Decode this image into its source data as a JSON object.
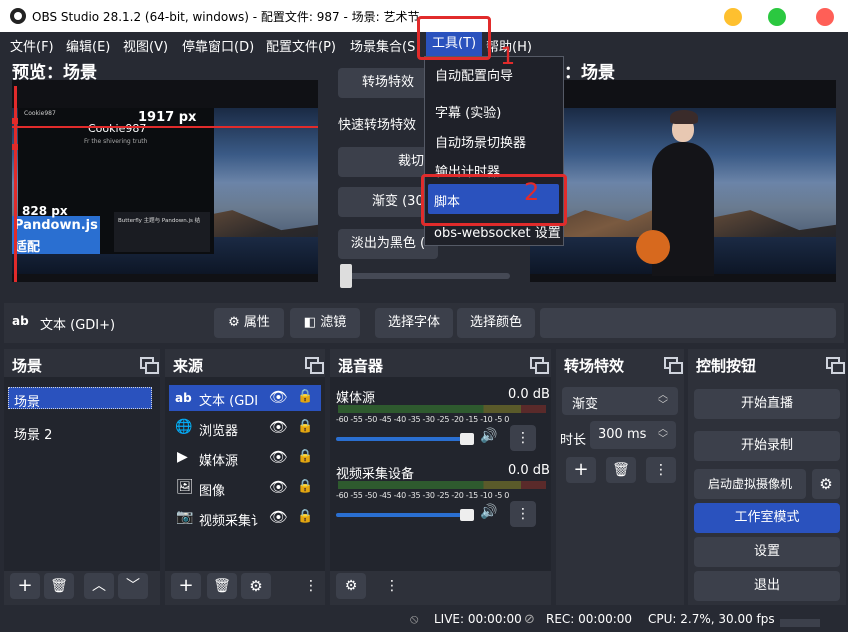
{
  "window": {
    "title": "OBS Studio 28.1.2 (64-bit, windows) - 配置文件: 987 - 场景: 艺术节"
  },
  "menubar": {
    "items": [
      "文件(F)",
      "编辑(E)",
      "视图(V)",
      "停靠窗口(D)",
      "配置文件(P)",
      "场景集合(S",
      "工具(T)",
      "帮助(H)"
    ]
  },
  "preview": {
    "left_title": "预览：场景",
    "right_title": "：场景",
    "overlay": {
      "px_w": "1917 px",
      "px_h": "828 px",
      "user": "Cookie987",
      "big_user": "Cookie987",
      "tagline": "Fr the shivering truth",
      "pandown": "Pandown.js",
      "adapt": "适配",
      "card": "Butterfly 主题与 Pandown.js 结"
    }
  },
  "transition_panel": {
    "trans_effect_btn": "转场特效",
    "quick_label": "快速转场特效",
    "cut_btn": "裁切",
    "fade_btn": "渐变 (300",
    "fade_black_btn": "淡出为黑色 ("
  },
  "tools_menu": {
    "items": [
      "自动配置向导",
      "字幕 (实验)",
      "自动场景切换器",
      "输出计时器",
      "脚本",
      "obs-websocket 设置"
    ]
  },
  "annotations": {
    "n1": "1",
    "n2": "2"
  },
  "context_bar": {
    "source_icon": "ab",
    "source_name": "文本 (GDI+)",
    "properties": "属性",
    "filters": "滤镜",
    "select_font": "选择字体",
    "select_color": "选择颜色"
  },
  "scenes_dock": {
    "title": "场景",
    "items": [
      "场景",
      "场景 2"
    ]
  },
  "sources_dock": {
    "title": "来源",
    "items": [
      {
        "icon": "text-icon",
        "label": "文本 (GDI",
        "glyph": "ab"
      },
      {
        "icon": "browser-icon",
        "label": "浏览器"
      },
      {
        "icon": "media-icon",
        "label": "媒体源"
      },
      {
        "icon": "image-icon",
        "label": "图像"
      },
      {
        "icon": "camera-icon",
        "label": "视频采集讠"
      }
    ]
  },
  "mixer_dock": {
    "title": "混音器",
    "channels": [
      {
        "name": "媒体源",
        "db": "0.0 dB"
      },
      {
        "name": "视频采集设备",
        "db": "0.0 dB"
      }
    ],
    "ticks": [
      "-60",
      "-55",
      "-50",
      "-45",
      "-40",
      "-35",
      "-30",
      "-25",
      "-20",
      "-15",
      "-10",
      "-5",
      "0"
    ]
  },
  "transitions_dock": {
    "title": "转场特效",
    "selected": "渐变",
    "duration_label": "时长",
    "duration_value": "300 ms"
  },
  "controls_dock": {
    "title": "控制按钮",
    "start_stream": "开始直播",
    "start_record": "开始录制",
    "virtual_cam": "启动虚拟摄像机",
    "studio_mode": "工作室模式",
    "settings": "设置",
    "exit": "退出"
  },
  "status_bar": {
    "live": "LIVE: 00:00:00",
    "rec": "REC: 00:00:00",
    "cpu": "CPU: 2.7%, 30.00 fps"
  },
  "colors": {
    "accent": "#2a52be",
    "annotation": "#e12b2b",
    "background": "#272a33",
    "panel": "#2e313a"
  }
}
